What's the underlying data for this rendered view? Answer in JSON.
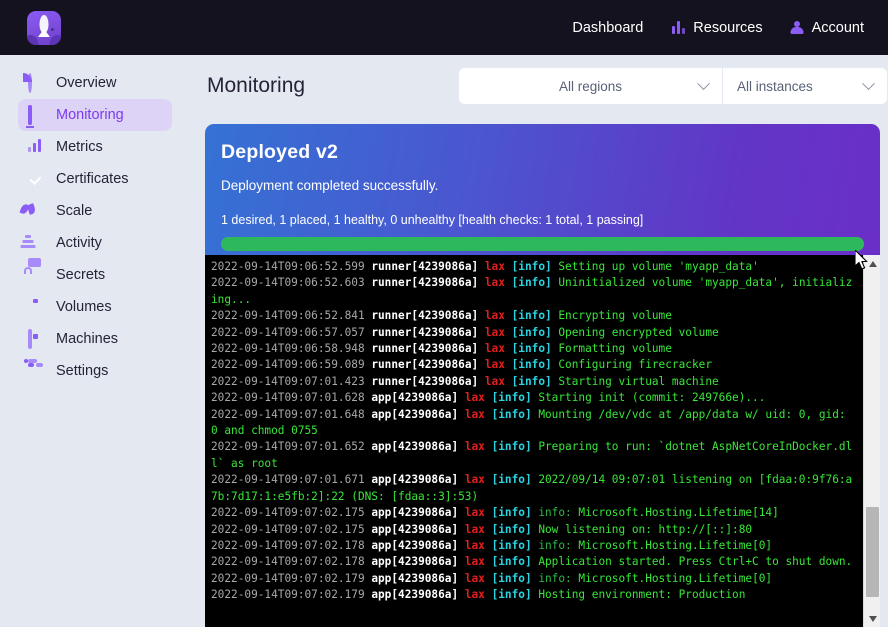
{
  "topbar": {
    "logo_name": "balloon-logo",
    "nav": [
      {
        "label": "Dashboard",
        "icon": "grid-icon"
      },
      {
        "label": "Resources",
        "icon": "bar-chart-icon"
      },
      {
        "label": "Account",
        "icon": "person-icon"
      }
    ]
  },
  "sidebar": {
    "items": [
      {
        "label": "Overview",
        "icon": "pie-chart-icon",
        "active": false
      },
      {
        "label": "Monitoring",
        "icon": "monitor-icon",
        "active": true
      },
      {
        "label": "Metrics",
        "icon": "bar-chart-icon",
        "active": false
      },
      {
        "label": "Certificates",
        "icon": "check-circle-icon",
        "active": false
      },
      {
        "label": "Scale",
        "icon": "leaf-icon",
        "active": false
      },
      {
        "label": "Activity",
        "icon": "stack-icon",
        "active": false
      },
      {
        "label": "Secrets",
        "icon": "lock-icon",
        "active": false
      },
      {
        "label": "Volumes",
        "icon": "box-icon",
        "active": false
      },
      {
        "label": "Machines",
        "icon": "chip-icon",
        "active": false
      },
      {
        "label": "Settings",
        "icon": "sliders-icon",
        "active": false
      }
    ]
  },
  "page": {
    "title": "Monitoring",
    "region_select": {
      "value": "All regions",
      "icon": "chevron-down-icon"
    },
    "instance_select": {
      "value": "All instances",
      "icon": "chevron-down-icon"
    }
  },
  "banner": {
    "title": "Deployed v2",
    "subtitle": "Deployment completed successfully.",
    "stats": "1 desired, 1 placed, 1 healthy, 0 unhealthy [health checks: 1 total, 1 passing]",
    "progress_percent": 100,
    "progress_color": "#2eb85c",
    "gradient_from": "#3572d4",
    "gradient_to": "#6a2fc9"
  },
  "terminal": {
    "scrollbar": {
      "up_icon": "triangle-up-icon",
      "down_icon": "triangle-down-icon"
    },
    "lines": [
      {
        "ts": "2022-09-14T09:06:52.599",
        "src": "runner[4239086a]",
        "region": "lax",
        "level": "[info]",
        "msg": "Setting up volume 'myapp_data'"
      },
      {
        "ts": "2022-09-14T09:06:52.603",
        "src": "runner[4239086a]",
        "region": "lax",
        "level": "[info]",
        "msg": "Uninitialized volume 'myapp_data', initializing..."
      },
      {
        "ts": "2022-09-14T09:06:52.841",
        "src": "runner[4239086a]",
        "region": "lax",
        "level": "[info]",
        "msg": "Encrypting volume"
      },
      {
        "ts": "2022-09-14T09:06:57.057",
        "src": "runner[4239086a]",
        "region": "lax",
        "level": "[info]",
        "msg": "Opening encrypted volume"
      },
      {
        "ts": "2022-09-14T09:06:58.948",
        "src": "runner[4239086a]",
        "region": "lax",
        "level": "[info]",
        "msg": "Formatting volume"
      },
      {
        "ts": "2022-09-14T09:06:59.089",
        "src": "runner[4239086a]",
        "region": "lax",
        "level": "[info]",
        "msg": "Configuring firecracker"
      },
      {
        "ts": "2022-09-14T09:07:01.423",
        "src": "runner[4239086a]",
        "region": "lax",
        "level": "[info]",
        "msg": "Starting virtual machine"
      },
      {
        "ts": "2022-09-14T09:07:01.628",
        "src": "app[4239086a]",
        "region": "lax",
        "level": "[info]",
        "msg": "Starting init (commit: 249766e)..."
      },
      {
        "ts": "2022-09-14T09:07:01.648",
        "src": "app[4239086a]",
        "region": "lax",
        "level": "[info]",
        "msg": "Mounting /dev/vdc at /app/data w/ uid: 0, gid: 0 and chmod 0755"
      },
      {
        "ts": "2022-09-14T09:07:01.652",
        "src": "app[4239086a]",
        "region": "lax",
        "level": "[info]",
        "msg": "Preparing to run: `dotnet AspNetCoreInDocker.dll` as root"
      },
      {
        "ts": "2022-09-14T09:07:01.671",
        "src": "app[4239086a]",
        "region": "lax",
        "level": "[info]",
        "msg": "2022/09/14 09:07:01 listening on [fdaa:0:9f76:a7b:7d17:1:e5fb:2]:22 (DNS: [fdaa::3]:53)"
      },
      {
        "ts": "2022-09-14T09:07:02.175",
        "src": "app[4239086a]",
        "region": "lax",
        "level": "[info]",
        "note": "info:",
        "msg": " Microsoft.Hosting.Lifetime[14]"
      },
      {
        "ts": "2022-09-14T09:07:02.175",
        "src": "app[4239086a]",
        "region": "lax",
        "level": "[info]",
        "msg": "Now listening on: http://[::]:80"
      },
      {
        "ts": "2022-09-14T09:07:02.178",
        "src": "app[4239086a]",
        "region": "lax",
        "level": "[info]",
        "note": "info:",
        "msg": " Microsoft.Hosting.Lifetime[0]"
      },
      {
        "ts": "2022-09-14T09:07:02.178",
        "src": "app[4239086a]",
        "region": "lax",
        "level": "[info]",
        "msg": "Application started. Press Ctrl+C to shut down."
      },
      {
        "ts": "2022-09-14T09:07:02.179",
        "src": "app[4239086a]",
        "region": "lax",
        "level": "[info]",
        "note": "info:",
        "msg": " Microsoft.Hosting.Lifetime[0]"
      },
      {
        "ts": "2022-09-14T09:07:02.179",
        "src": "app[4239086a]",
        "region": "lax",
        "level": "[info]",
        "msg": "Hosting environment: Production"
      }
    ]
  }
}
